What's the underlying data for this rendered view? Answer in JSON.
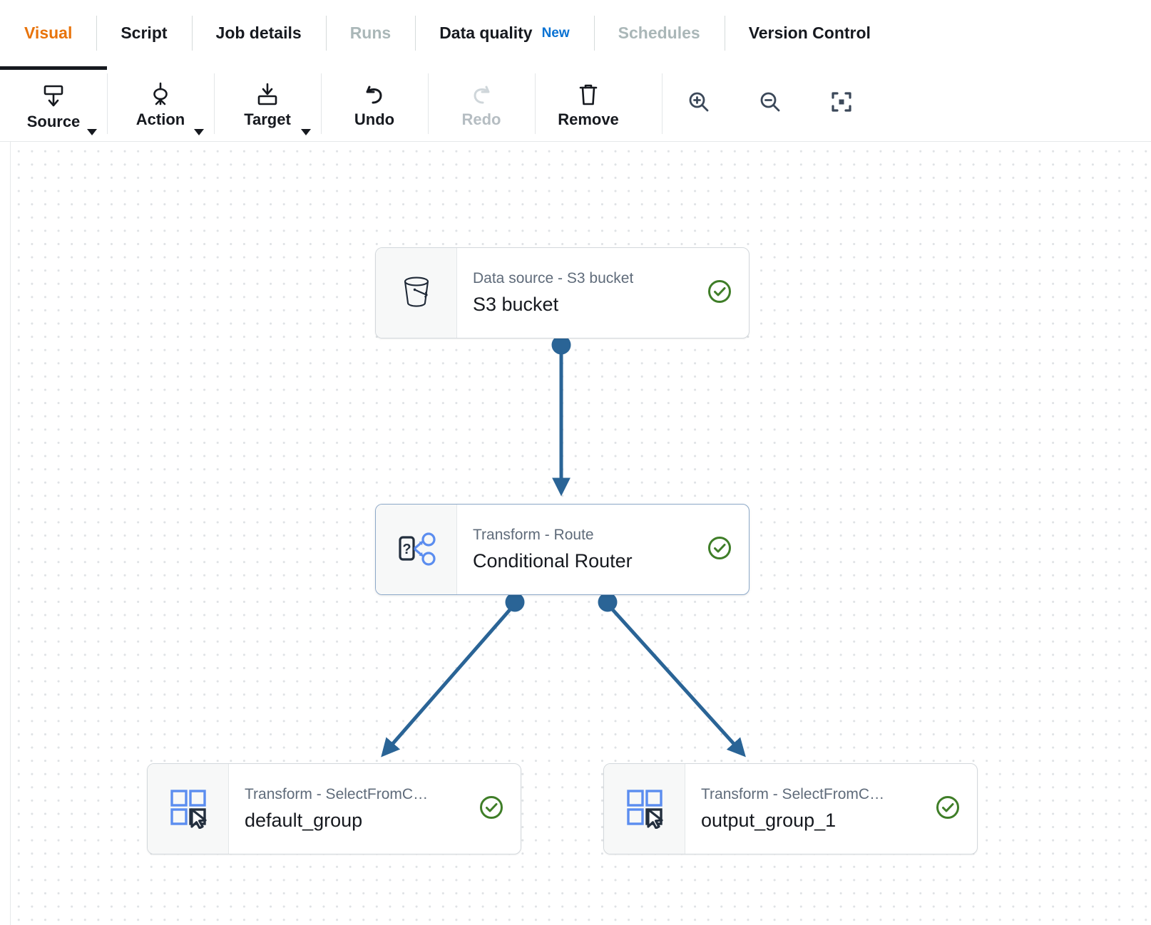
{
  "tabs": [
    {
      "label": "Visual",
      "state": "active"
    },
    {
      "label": "Script",
      "state": "normal"
    },
    {
      "label": "Job details",
      "state": "normal"
    },
    {
      "label": "Runs",
      "state": "disabled"
    },
    {
      "label": "Data quality",
      "state": "normal",
      "badge": "New"
    },
    {
      "label": "Schedules",
      "state": "disabled"
    },
    {
      "label": "Version Control",
      "state": "normal"
    }
  ],
  "toolbar": {
    "items": [
      {
        "label": "Source",
        "icon": "source-icon",
        "caret": true,
        "disabled": false
      },
      {
        "label": "Action",
        "icon": "action-icon",
        "caret": true,
        "disabled": false
      },
      {
        "label": "Target",
        "icon": "target-icon",
        "caret": true,
        "disabled": false
      },
      {
        "label": "Undo",
        "icon": "undo-icon",
        "caret": false,
        "disabled": false
      },
      {
        "label": "Redo",
        "icon": "redo-icon",
        "caret": false,
        "disabled": true
      },
      {
        "label": "Remove",
        "icon": "trash-icon",
        "caret": false,
        "disabled": false
      }
    ],
    "zoom_controls": [
      {
        "name": "zoom-in-icon"
      },
      {
        "name": "zoom-out-icon"
      },
      {
        "name": "fit-to-screen-icon"
      }
    ]
  },
  "canvas": {
    "nodes": [
      {
        "id": "s3-source",
        "sub": "Data source - S3 bucket",
        "title": "S3 bucket",
        "icon": "s3-bucket-icon",
        "status": "valid",
        "selected": false
      },
      {
        "id": "conditional-router",
        "sub": "Transform - Route",
        "title": "Conditional Router",
        "icon": "route-icon",
        "status": "valid",
        "selected": true
      },
      {
        "id": "default-group",
        "sub": "Transform - SelectFromC…",
        "title": "default_group",
        "icon": "select-from-collection-icon",
        "status": "valid",
        "selected": false
      },
      {
        "id": "output-group-1",
        "sub": "Transform - SelectFromC…",
        "title": "output_group_1",
        "icon": "select-from-collection-icon",
        "status": "valid",
        "selected": false
      }
    ]
  },
  "colors": {
    "accent_orange": "#e8730a",
    "link_blue": "#0972d3",
    "edge_blue": "#2a6496",
    "status_green": "#3f7e28",
    "icon_blue": "#5b8def",
    "text_dark": "#16191f",
    "text_muted": "#5f6b7a",
    "disabled": "#aab7b8"
  }
}
